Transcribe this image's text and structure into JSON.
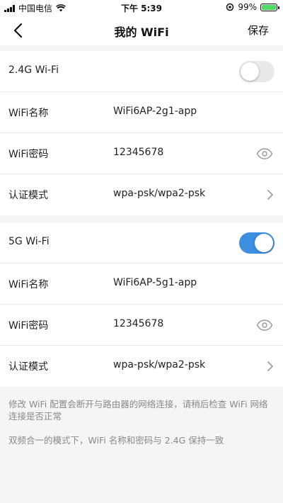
{
  "status_bar": {
    "carrier": "中国电信",
    "time": "下午 5:39",
    "battery_percent": "99%",
    "battery_color": "#4cd964"
  },
  "nav": {
    "back_icon": "chevron-left-icon",
    "title": "我的 WiFi",
    "save_label": "保存"
  },
  "band_24": {
    "label": "2.4G Wi-Fi",
    "enabled": false,
    "name_label": "WiFi名称",
    "name_value": "WiFi6AP-2g1-app",
    "password_label": "WiFi密码",
    "password_value": "12345678",
    "auth_label": "认证模式",
    "auth_value": "wpa-psk/wpa2-psk"
  },
  "band_5": {
    "label": "5G Wi-Fi",
    "enabled": true,
    "name_label": "WiFi名称",
    "name_value": "WiFi6AP-5g1-app",
    "password_label": "WiFi密码",
    "password_value": "12345678",
    "auth_label": "认证模式",
    "auth_value": "wpa-psk/wpa2-psk"
  },
  "notes": {
    "line1": "修改 WiFi 配置会断开与路由器的网络连接，请稍后检查 WiFi 网络连接是否正常",
    "line2": "双频合一的模式下，WiFi 名称和密码与 2.4G 保持一致"
  },
  "colors": {
    "accent": "#3d8fe0",
    "toggle_off": "#e9e9ea",
    "note_text": "#8a8a8a"
  }
}
